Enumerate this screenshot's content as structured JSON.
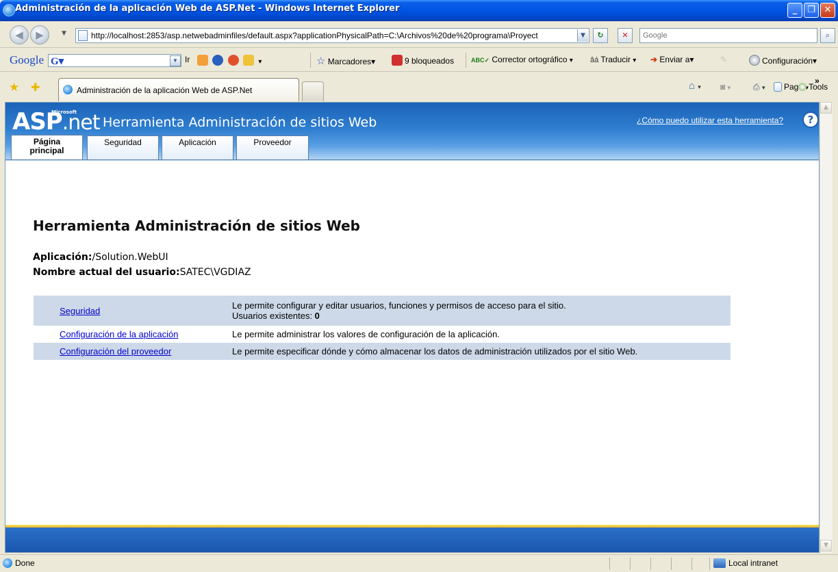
{
  "window": {
    "title": "Administración de la aplicación Web de ASP.Net - Windows Internet Explorer",
    "controls": {
      "minimize": "_",
      "maximize": "❐",
      "close": "✕"
    }
  },
  "address_bar": {
    "url": "http://localhost:2853/asp.netwebadminfiles/default.aspx?applicationPhysicalPath=C:\\Archivos%20de%20programa\\Proyect",
    "search_placeholder": "Google"
  },
  "google_toolbar": {
    "brand": "Google",
    "go_label": "Ir",
    "bookmarks": "Marcadores▾",
    "blocked": "9 bloqueados",
    "spell": "Corrector ortográfico",
    "translate": "Traducir",
    "send": "Enviar a▾",
    "settings": "Configuración▾"
  },
  "browser_tab": {
    "label": "Administración de la aplicación Web de ASP.Net"
  },
  "command_bar": {
    "page": "Page",
    "tools": "Tools",
    "more": "»"
  },
  "site": {
    "logo_main": "ASP",
    "logo_net": ".net",
    "logo_ms": "Microsoft",
    "banner_title": "Herramienta Administración de sitios Web",
    "help_link": "¿Cómo puedo utilizar esta herramienta?",
    "help_icon": "?",
    "tabs": [
      {
        "line1": "Página",
        "line2": "principal"
      },
      {
        "line1": "Seguridad",
        "line2": ""
      },
      {
        "line1": "Aplicación",
        "line2": ""
      },
      {
        "line1": "Proveedor",
        "line2": ""
      }
    ],
    "page_title": "Herramienta Administración de sitios Web",
    "application_label": "Aplicación:",
    "application_value": "/Solution.WebUI",
    "user_label": "Nombre actual del usuario:",
    "user_value": "SATEC\\VGDIAZ",
    "rows": [
      {
        "link": "Seguridad",
        "desc": "Le permite configurar y editar usuarios, funciones y permisos de acceso para el sitio.",
        "extra_label": "Usuarios existentes: ",
        "extra_value": "0"
      },
      {
        "link": "Configuración de la aplicación",
        "desc": "Le permite administrar los valores de configuración de la aplicación."
      },
      {
        "link": "Configuración del proveedor",
        "desc": "Le permite especificar dónde y cómo almacenar los datos de administración utilizados por el sitio Web."
      }
    ]
  },
  "status_bar": {
    "left": "Done",
    "zone": "Local intranet"
  }
}
